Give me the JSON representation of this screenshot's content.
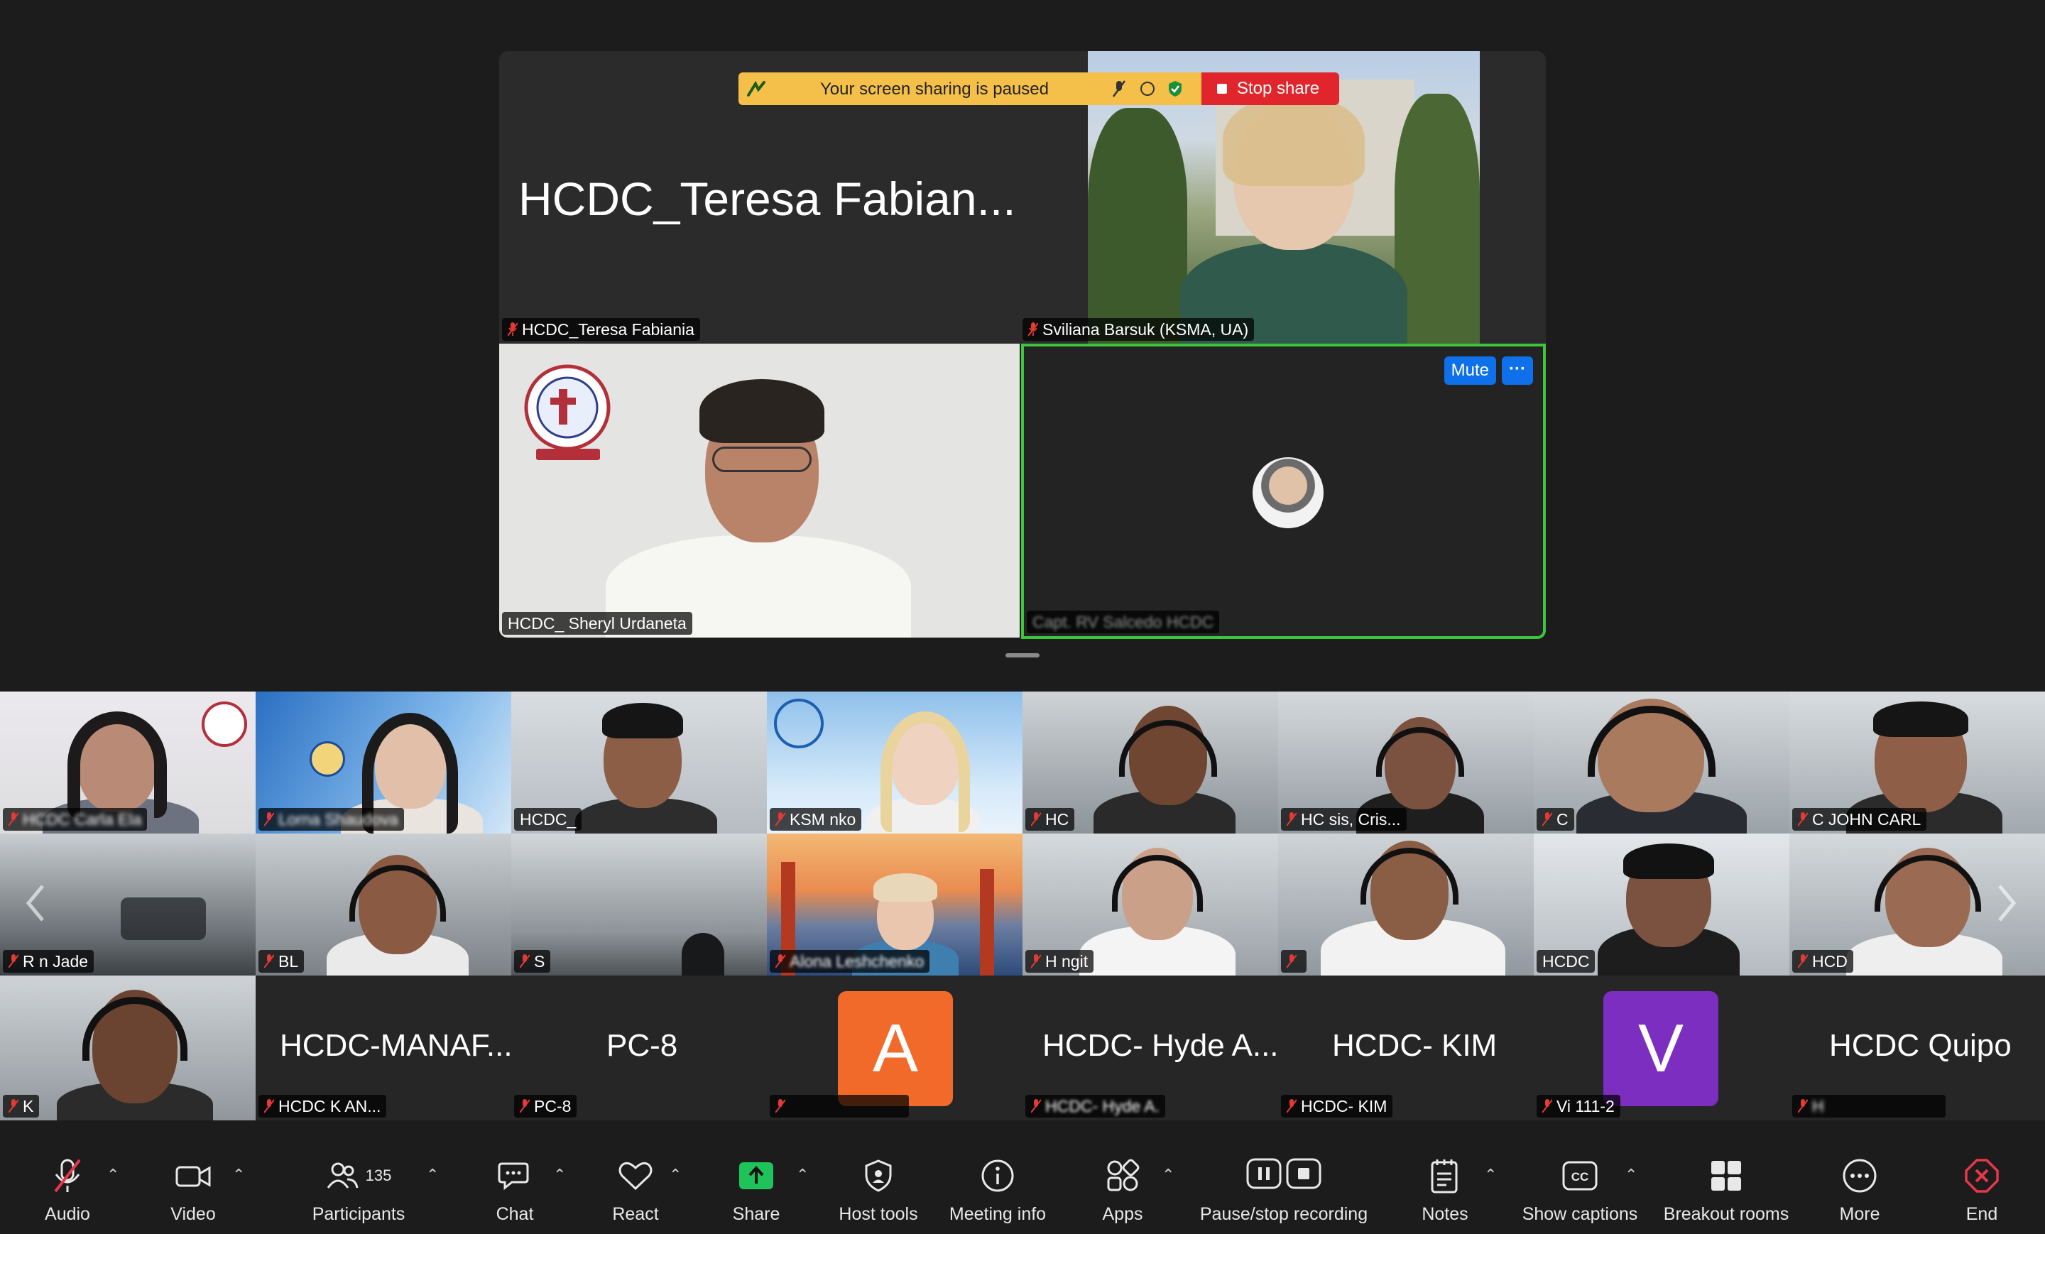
{
  "share_banner": {
    "text": "Your screen sharing is paused",
    "stop_label": "Stop share"
  },
  "speakers": [
    {
      "big_name": "HCDC_Teresa Fabian...",
      "name": "HCDC_Teresa Fabiania"
    },
    {
      "name": "Sviliana Barsuk (KSMA, UA)"
    },
    {
      "name": "HCDC_ Sheryl Urdaneta"
    },
    {
      "name": "Capt. RV Salcedo HCDC"
    }
  ],
  "active_tile": {
    "mute_label": "Mute",
    "more_label": "···"
  },
  "gallery": {
    "row1": [
      {
        "name": "HCDC Carla Ela"
      },
      {
        "name": "Lorna Shaudova"
      },
      {
        "name": "HCDC_"
      },
      {
        "name": "KSM          nko"
      },
      {
        "name": "HC"
      },
      {
        "name": "HC                sis, Cris..."
      },
      {
        "name": "C"
      },
      {
        "name": "C                  JOHN CARL"
      }
    ],
    "row2": [
      {
        "name": "R                  n Jade"
      },
      {
        "name": "BL"
      },
      {
        "name": "S"
      },
      {
        "name": "Alona Leshchenko"
      },
      {
        "name": "H                 ngit"
      },
      {
        "name": ""
      },
      {
        "name": "HCDC"
      },
      {
        "name": "HCD"
      }
    ],
    "row3": [
      {
        "name": "K"
      },
      {
        "big_name": "HCDC-MANAF...",
        "name": "HCDC                K AN..."
      },
      {
        "big_name": "PC-8",
        "name": "PC-8"
      },
      {
        "avatar_letter": "A",
        "avatar_color": "#f26a2a",
        "name": ""
      },
      {
        "big_name": "HCDC- Hyde A....",
        "name": "HCDC- Hyde A."
      },
      {
        "big_name": "HCDC- KIM",
        "name": "HCDC- KIM"
      },
      {
        "avatar_letter": "V",
        "avatar_color": "#7b2ec0",
        "name": "Vi             111-2"
      },
      {
        "big_name": "HCDC Quipo",
        "name": "H"
      }
    ]
  },
  "toolbar": {
    "audio": "Audio",
    "video": "Video",
    "participants": "Participants",
    "participants_count": "135",
    "chat": "Chat",
    "react": "React",
    "share": "Share",
    "host_tools": "Host tools",
    "meeting_info": "Meeting info",
    "apps": "Apps",
    "recording": "Pause/stop recording",
    "notes": "Notes",
    "captions": "Show captions",
    "breakout": "Breakout rooms",
    "more": "More",
    "end": "End"
  },
  "colors": {
    "share_banner": "#f5c04a",
    "stop_share": "#e0262c",
    "active_border": "#3cc63c",
    "mute_button": "#0e71eb",
    "end_icon": "#e8364a",
    "share_icon": "#1ec35a"
  },
  "icons": [
    "mic-off-icon",
    "video-icon",
    "participants-icon",
    "chat-icon",
    "heart-icon",
    "share-arrow-icon",
    "shield-icon",
    "info-icon",
    "apps-icon",
    "pause-icon",
    "stop-icon",
    "notes-icon",
    "cc-icon",
    "grid-icon",
    "more-icon",
    "close-icon",
    "chevron-left-icon",
    "chevron-right-icon"
  ]
}
